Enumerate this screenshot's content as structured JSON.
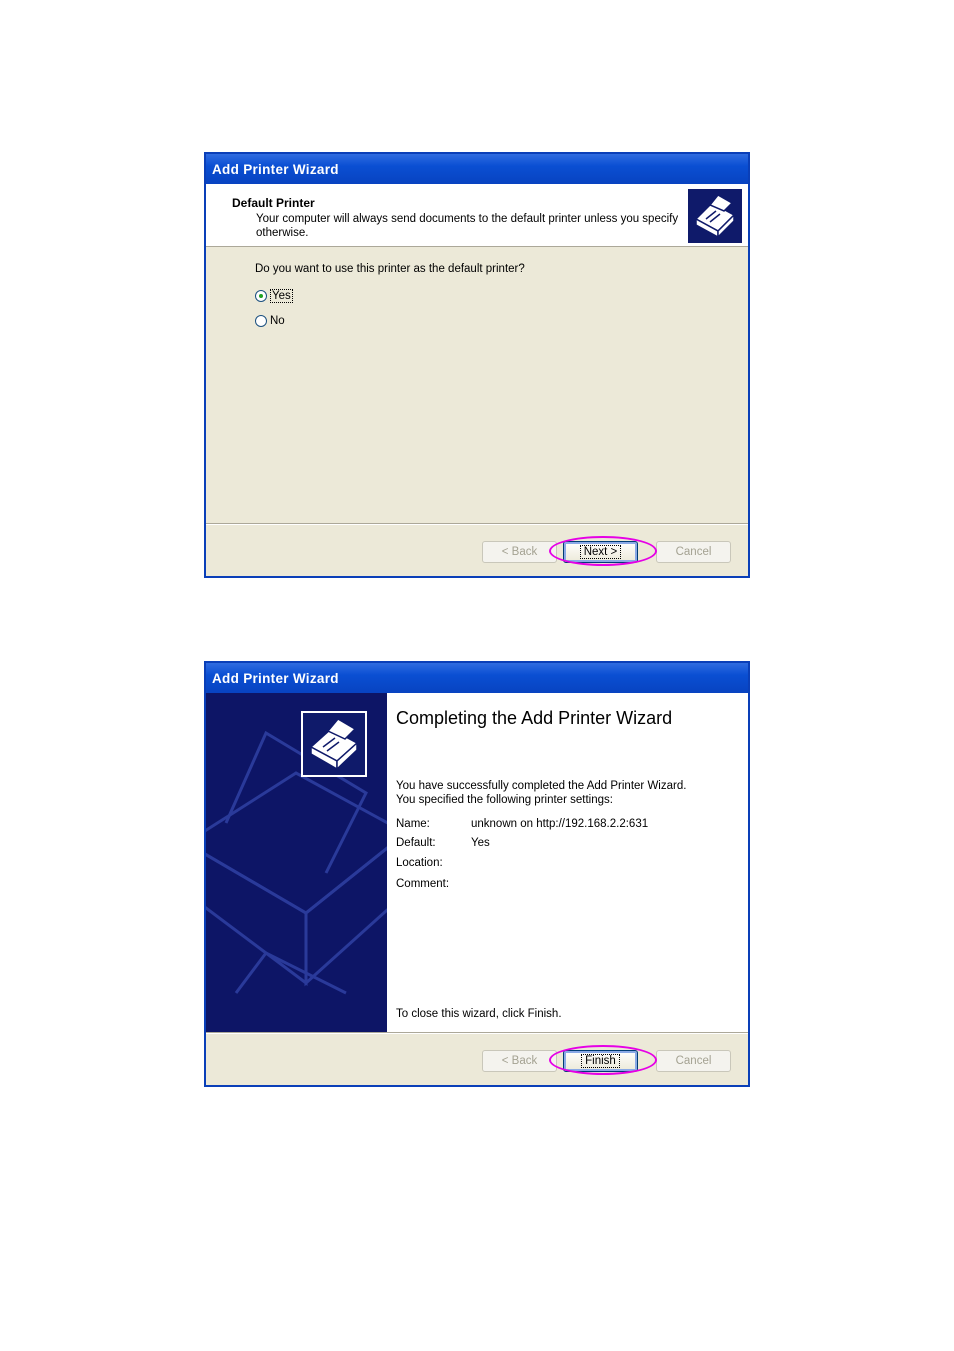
{
  "dialog1": {
    "title": "Add Printer Wizard",
    "header_title": "Default Printer",
    "header_subtitle": "Your computer will always send documents to the default printer unless you specify otherwise.",
    "question": "Do you want to use this printer as the default printer?",
    "options": [
      {
        "label": "Yes",
        "checked": true
      },
      {
        "label": "No",
        "checked": false
      }
    ],
    "buttons": {
      "back": "< Back",
      "next": "Next >",
      "cancel": "Cancel"
    },
    "highlight_color": "#e600e6"
  },
  "dialog2": {
    "title": "Add Printer Wizard",
    "heading": "Completing the Add Printer Wizard",
    "line1": "You have successfully completed the Add Printer Wizard.",
    "line2": "You specified the following printer settings:",
    "settings": [
      {
        "key": "Name:",
        "value": "unknown on http://192.168.2.2:631"
      },
      {
        "key": "Default:",
        "value": "Yes"
      },
      {
        "key": "Location:",
        "value": ""
      },
      {
        "key": "Comment:",
        "value": ""
      }
    ],
    "closing": "To close this wizard, click Finish.",
    "buttons": {
      "back": "< Back",
      "finish": "Finish",
      "cancel": "Cancel"
    },
    "highlight_color": "#e600e6"
  },
  "icons": {
    "printer": "printer-icon"
  },
  "colors": {
    "titlebar": "#0a4fd3",
    "dialog_bg": "#ece9d8",
    "side_panel": "#0d1566"
  }
}
